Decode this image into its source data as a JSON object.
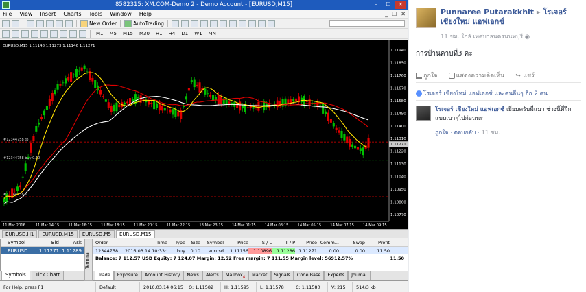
{
  "window": {
    "title": "8582315: XM.COM-Demo 2 - Demo Account - [EURUSD,M15]",
    "min": "–",
    "max": "☐",
    "close": "✕"
  },
  "menu": [
    "File",
    "View",
    "Insert",
    "Charts",
    "Tools",
    "Window",
    "Help"
  ],
  "mdi_controls": [
    "_",
    "☐",
    "✕"
  ],
  "toolbar": {
    "new_order": "New Order",
    "autotrading": "AutoTrading",
    "timeframes": [
      "M1",
      "M5",
      "M15",
      "M30",
      "H1",
      "H4",
      "D1",
      "W1",
      "MN"
    ]
  },
  "chart": {
    "header": "EURUSD,M15  1.11148 1.11273 1.11146 1.11271",
    "price_labels": [
      "1.11940",
      "1.11850",
      "1.11760",
      "1.11670",
      "1.11580",
      "1.11490",
      "1.11400",
      "1.11310",
      "1.11220",
      "1.11130",
      "1.11040",
      "1.10950",
      "1.10860",
      "1.10770"
    ],
    "current_price": "1.11271",
    "time_labels": [
      "11 Mar 2016",
      "11 Mar 14:15",
      "11 Mar 16:15",
      "11 Mar 18:15",
      "11 Mar 20:15",
      "11 Mar 22:15",
      "13 Mar 23:15",
      "14 Mar 01:15",
      "14 Mar 03:15",
      "14 Mar 05:15",
      "14 Mar 07:15",
      "14 Mar 09:15"
    ],
    "order_labels": {
      "tp": "#12344758 tp",
      "buy": "#12344758 buy 0.10",
      "sl": "#12344758 sl"
    },
    "colors": {
      "bull": "#00c000",
      "bear": "#e00000",
      "ma_fast": "#ffe000",
      "ma_mid": "#e00000",
      "ma_slow": "#ffffff",
      "tp": "#e00000",
      "buy": "#00a000"
    }
  },
  "symbol_tabs": [
    "EURUSD,H1",
    "EURUSD,M15",
    "EURUSD,M5",
    "EURUSD,M15"
  ],
  "market_watch": {
    "headers": [
      "Symbol",
      "Bid",
      "Ask"
    ],
    "rows": [
      {
        "symbol": "EURUSD",
        "bid": "1.11271",
        "ask": "1.11289"
      }
    ],
    "tabs": [
      "Symbols",
      "Tick Chart"
    ]
  },
  "terminal": {
    "side_label": "Terminal",
    "headers": [
      "Order",
      "Time",
      "Type",
      "Size",
      "Symbol",
      "Price",
      "S / L",
      "T / P",
      "Price",
      "Comm...",
      "Swap",
      "Profit"
    ],
    "order": {
      "order": "12344758",
      "time": "2016.03.14 10:33:55",
      "type": "buy",
      "size": "0.10",
      "symbol": "eurusd",
      "price": "1.11156",
      "sl": "1.10896",
      "tp": "1.11286",
      "price2": "1.11271",
      "comm": "0.00",
      "swap": "0.00",
      "profit": "11.50"
    },
    "balance_line": "Balance: 7 112.57 USD  Equity: 7 124.07  Margin: 12.52  Free margin: 7 111.55  Margin level: 56912.57%",
    "balance_profit": "11.50",
    "tabs": [
      "Trade",
      "Exposure",
      "Account History",
      "News",
      "Alerts",
      "Mailbox",
      "Market",
      "Signals",
      "Code Base",
      "Experts",
      "Journal"
    ],
    "mailbox_badge": "4"
  },
  "status": [
    "For Help, press F1",
    "Default",
    "2016.03.14 06:15",
    "O: 1.11582",
    "H: 1.11595",
    "L: 1.11578",
    "C: 1.11580",
    "V: 215",
    "514/3 kb"
  ],
  "facebook": {
    "poster": "Punnaree Putarakkhit",
    "arrow": "▸",
    "target": "โรเจอร์ เชียงใหม่ แอฟเอกซ์",
    "meta": "11 ชม. ใกล้ เทศบาลนครนนทบุรี",
    "post_text": "การบ้านคาบที่3 คะ",
    "actions": [
      "ถูกใจ",
      "แสดงความคิดเห็น",
      "แชร์"
    ],
    "likes": "โรเจอร์ เชียงใหม่ แอฟเอกซ์ และคนอื่นๆ อีก 2 คน",
    "comment": {
      "name": "โรเจอร์ เชียงใหม่ แอฟเอกซ์",
      "text": " เยี่ยมครับพี่แมว ช่วงนี้ที่ฝึกแบบเบาๆไปก่อนนะ",
      "like": "ถูกใจ",
      "reply": "ตอบกลับ",
      "time": "11 ชม."
    },
    "colors": {
      "link": "#3b5998",
      "meta": "#90949c"
    }
  }
}
